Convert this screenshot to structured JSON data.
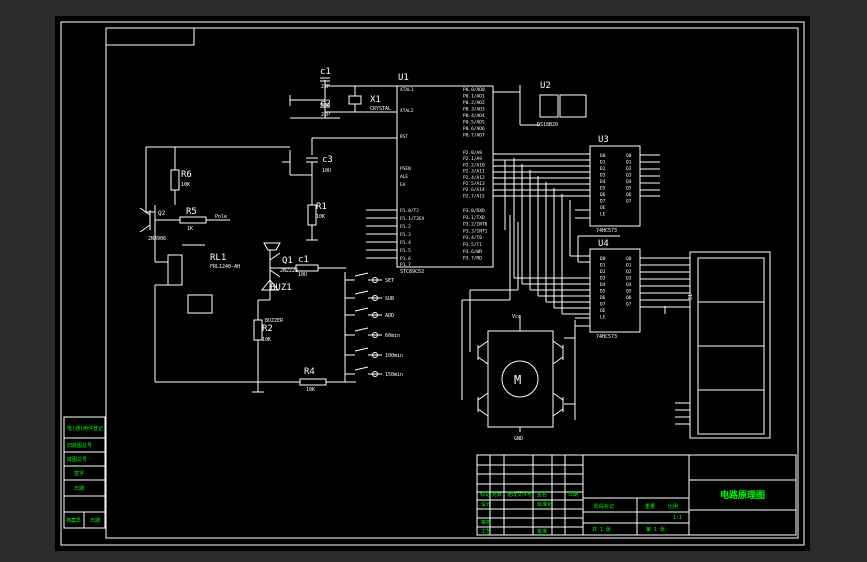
{
  "title_block": {
    "drawing_title": "电路原理图",
    "scale": "1:1",
    "sheet_left": "共 1 张",
    "sheet_right": "第 1 张",
    "label_row1": [
      "标记",
      "处数",
      "更改文件号",
      "签名",
      "日期"
    ],
    "label_row2": [
      "设计",
      "标准化"
    ],
    "label_stage": [
      "阶段标记",
      "重量",
      "比例"
    ],
    "label_review": "审核",
    "label_process": "工艺",
    "label_approve": "批准"
  },
  "left_strip": {
    "cells": [
      "借(通)用件登记",
      "旧底图总号",
      "底图总号",
      "签字",
      "日期",
      "档案员",
      "日期"
    ]
  },
  "components": {
    "u1_ref": "U1",
    "u1_part": "STC89C52",
    "u2_ref": "U2",
    "u2_part": "DS18B20",
    "u3_ref": "U3",
    "u3_part": "74HC573",
    "u4_ref": "U4",
    "u4_part": "74HC573",
    "x1_ref": "X1",
    "x1_part": "CRYSTAL",
    "c1_ref": "c1",
    "c1_val": "22P",
    "c2_ref": "c2",
    "c2_val": "22P",
    "c3_ref": "c3",
    "c3_val": "10U",
    "c1b_ref": "c1",
    "c1b_val": "10U",
    "r1_ref": "R1",
    "r1_val": "10K",
    "r2_ref": "R2",
    "r2_val": "10K",
    "r4_ref": "R4",
    "r4_val": "10K",
    "r5_ref": "R5",
    "r5_val": "1K",
    "r6_ref": "R6",
    "r6_val": "10K",
    "q1_ref": "Q1",
    "q1_part": "2N2222",
    "q2_ref": "Q2",
    "q2_part": "2N3906",
    "rl1_ref": "RL1",
    "rl1_part": "FRL1240-AH",
    "buz_ref": "BUZ1",
    "buz_part": "BUZZER",
    "motor": "M",
    "display_ref": "J1",
    "vcc": "Vcc",
    "gnd": "GND",
    "pole_label": "Pole",
    "buttons": [
      "SET",
      "SUB",
      "ADD",
      "60min",
      "100min",
      "150min"
    ]
  },
  "u1_pins_left": [
    "XTAL1",
    "XTAL2",
    "RST",
    "PSEN",
    "ALE",
    "EA",
    "P1.0/T2",
    "P1.1/T2EX",
    "P1.2",
    "P1.3",
    "P1.4",
    "P1.5",
    "P1.6",
    "P1.7"
  ],
  "u1_pins_right": [
    "P0.0/AD0",
    "P0.1/AD1",
    "P0.2/AD2",
    "P0.3/AD3",
    "P0.4/AD4",
    "P0.5/AD5",
    "P0.6/AD6",
    "P0.7/AD7",
    "P2.0/A8",
    "P2.1/A9",
    "P2.2/A10",
    "P2.3/A11",
    "P2.4/A12",
    "P2.5/A13",
    "P2.6/A14",
    "P2.7/A15",
    "P3.0/RXD",
    "P3.1/TXD",
    "P3.2/INT0",
    "P3.3/INT1",
    "P3.4/T0",
    "P3.5/T1",
    "P3.6/WR",
    "P3.7/RD"
  ],
  "latch_pins_left": [
    "D0",
    "D1",
    "D2",
    "D3",
    "D4",
    "D5",
    "D6",
    "D7",
    "OE",
    "LE"
  ],
  "latch_pins_right": [
    "Q0",
    "Q1",
    "Q2",
    "Q3",
    "Q4",
    "Q5",
    "Q6",
    "Q7"
  ],
  "colors": {
    "background": "#000000",
    "outer": "#2b2b2b",
    "wire": "#ffffff",
    "label": "#ffffff",
    "title_text": "#00ff00"
  }
}
